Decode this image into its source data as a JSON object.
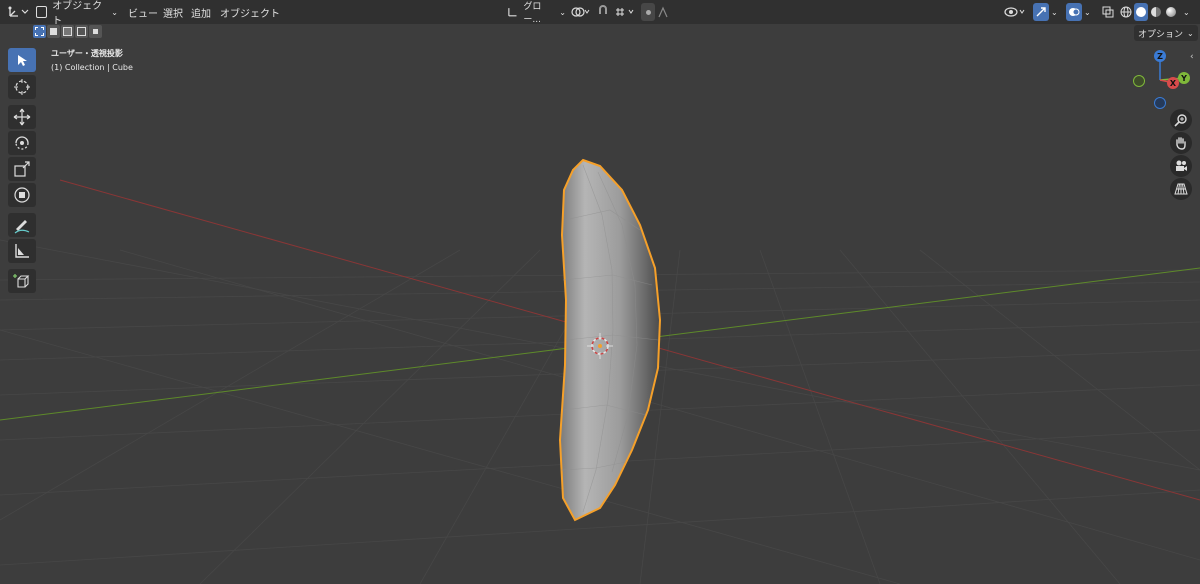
{
  "header": {
    "mode_label": "オブジェクト",
    "menus": [
      "ビュー",
      "選択",
      "追加",
      "オブジェクト"
    ],
    "transform_orientation": "グロー..."
  },
  "viewport_info": {
    "view_name": "ユーザー・透視投影",
    "collection_line": "(1) Collection | Cube"
  },
  "options_label": "オプション",
  "gizmo": {
    "z": "Z",
    "y": "Y",
    "x": "X"
  },
  "colors": {
    "viewport_bg": "#3d3d3d",
    "header_bg": "#303030",
    "accent": "#4772b3",
    "selection_outline": "#f5a02a",
    "x_axis": "#a33b3b",
    "y_axis": "#6a9a2b"
  }
}
